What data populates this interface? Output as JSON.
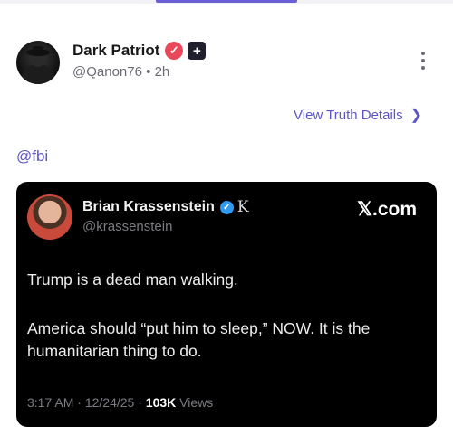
{
  "post": {
    "author_name": "Dark Patriot",
    "handle": "@Qanon76",
    "separator": "•",
    "time_ago": "2h",
    "verified_mark": "✓",
    "plus_mark": "+",
    "view_details_label": "View Truth Details",
    "view_details_chevron": "❯",
    "mention": "@fbi"
  },
  "embedded_tweet": {
    "author_name": "Brian Krassenstein",
    "check_mark": "✓",
    "affiliate_mark": "K",
    "handle": "@krassenstein",
    "source_logo": "𝕏.com",
    "paragraph1": "Trump is a dead man walking.",
    "paragraph2": "America should “put him to sleep,” NOW.  It is the humanitarian thing to do.",
    "time": "3:17 AM",
    "date": "12/24/25",
    "views_count": "103K",
    "views_label": "Views",
    "dot": "·"
  },
  "icons": {
    "more": "more-vertical-icon",
    "chevron": "chevron-right-icon",
    "verified": "verified-badge-icon"
  },
  "colors": {
    "accent": "#5b55c8",
    "verified_badge": "#e8495a",
    "tweet_background": "#000000",
    "x_verified": "#2f9bf0"
  }
}
